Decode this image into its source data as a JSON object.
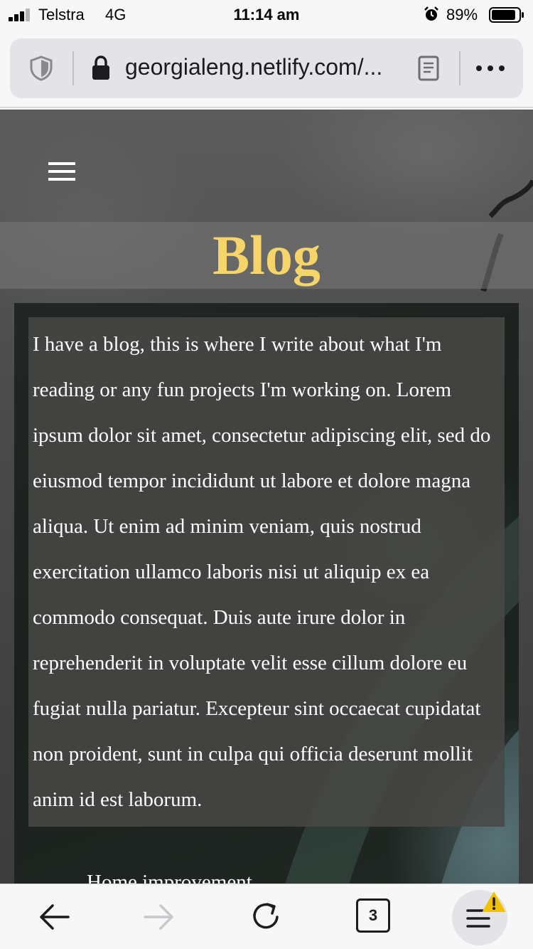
{
  "status_bar": {
    "carrier": "Telstra",
    "network": "4G",
    "time": "11:14 am",
    "battery": "89%",
    "battery_level": 0.89,
    "signal_bars": 3,
    "icons": [
      "signal-icon",
      "alarm-icon",
      "battery-icon"
    ]
  },
  "browser": {
    "url": "georgialeng.netlify.com/...",
    "icons": [
      "shield-icon",
      "lock-icon",
      "reader-view-icon",
      "more-icon"
    ]
  },
  "page": {
    "title": "Blog",
    "title_color": "#f5d56a",
    "body": "I have a blog, this is where I write about what I'm reading or any fun projects I'm working on. Lorem ipsum dolor sit amet, consectetur adipiscing elit, sed do eiusmod tempor incididunt ut labore et dolore magna aliqua. Ut enim ad minim veniam, quis nostrud exercitation ullamco laboris nisi ut aliquip ex ea commodo consequat. Duis aute irure dolor in reprehenderit in voluptate velit esse cillum dolore eu fugiat nulla pariatur. Excepteur sint occaecat cupidatat non proident, sunt in culpa qui officia deserunt mollit anim id est laborum.",
    "first_link": "Home improvement"
  },
  "toolbar": {
    "tab_count": "3",
    "warning_color": "#f2c200",
    "icons": [
      "back-arrow-icon",
      "forward-arrow-icon",
      "reload-icon",
      "tabs-icon",
      "app-menu-icon",
      "warning-icon"
    ]
  }
}
